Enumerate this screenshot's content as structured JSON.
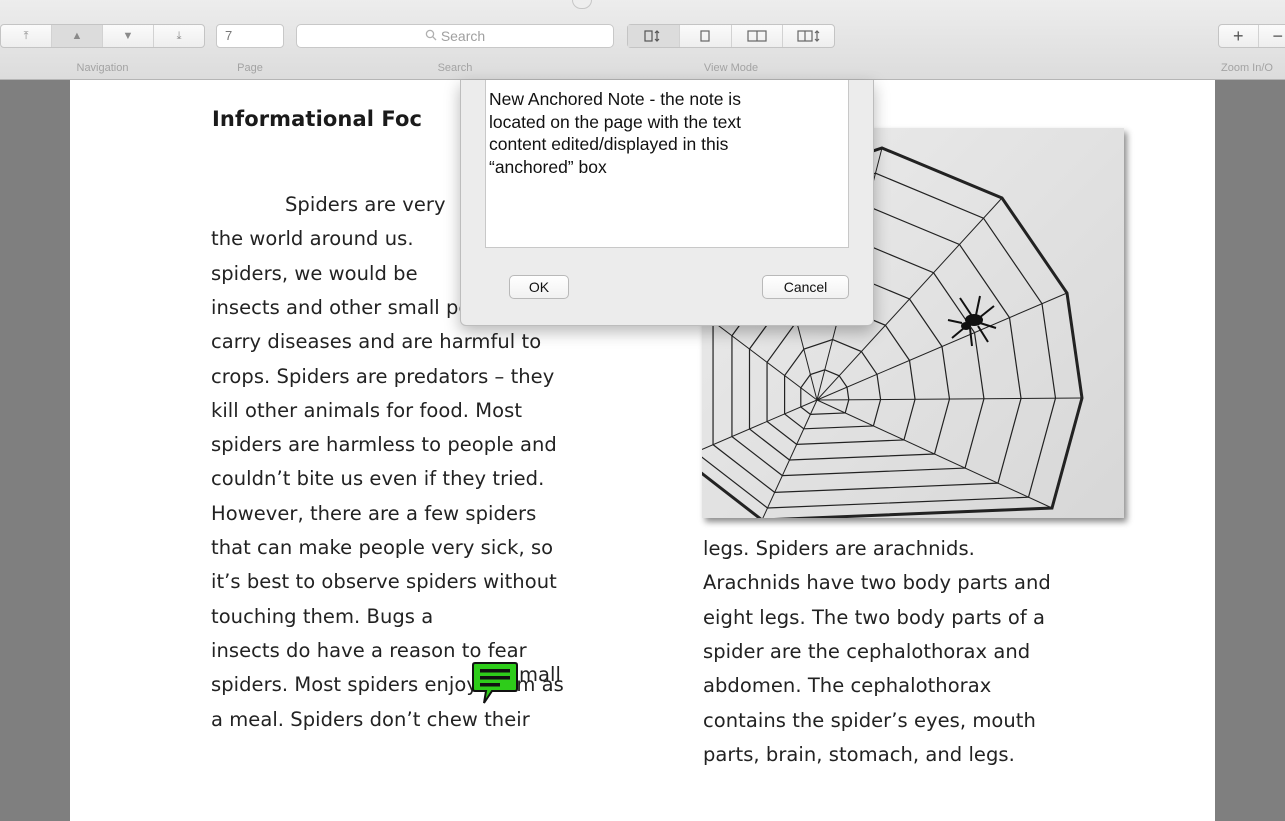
{
  "toolbar": {
    "navigation": {
      "label": "Navigation",
      "buttons": [
        "first-page-icon",
        "previous-page-icon",
        "next-page-icon",
        "last-page-icon"
      ]
    },
    "page": {
      "label": "Page",
      "value": "7"
    },
    "search": {
      "label": "Search",
      "placeholder": "Search"
    },
    "view_mode": {
      "label": "View Mode",
      "buttons": [
        "single-continuous-icon",
        "single-page-icon",
        "two-page-icon",
        "two-page-continuous-icon"
      ]
    },
    "zoom": {
      "label": "Zoom In/O"
    }
  },
  "document": {
    "title": "Informational Foc",
    "left_column": [
      "Spiders are very",
      "the world around us.",
      "spiders, we would be",
      "insects and other small pests that",
      "carry diseases and are harmful to",
      "crops.  Spiders are predators – they",
      "kill other animals for food.  Most",
      "spiders are harmless to people and",
      "couldn’t bite us even if they tried.",
      "However, there are a few spiders",
      "that can make people very sick, so",
      "it’s best to observe spiders without",
      "touching them.  Bugs a",
      "insects do have a reason to fear",
      "spiders.  Most spiders enjoy them as",
      "a meal.  Spiders don’t chew their"
    ],
    "left_fragment": "mall",
    "right_column": [
      "legs.  Spiders are arachnids.",
      "Arachnids have two body parts and",
      "eight legs.  The two body parts of a",
      "spider are the cephalothorax and",
      "abdomen.  The cephalothorax",
      "contains the spider’s eyes, mouth",
      "parts, brain, stomach, and legs."
    ]
  },
  "note_popover": {
    "text": "New Anchored Note - the note is\nlocated on the page with the text\ncontent edited/displayed in this\n“anchored” box",
    "ok_label": "OK",
    "cancel_label": "Cancel"
  },
  "colors": {
    "note_icon": "#2ecc1a",
    "page_bg": "#ffffff",
    "gutter": "#7f7f7f"
  }
}
